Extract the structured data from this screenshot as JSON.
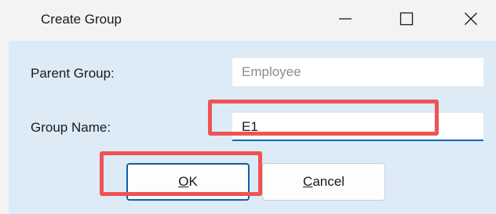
{
  "window": {
    "title": "Create Group",
    "controls": [
      "minimize-icon",
      "maximize-icon",
      "close-icon"
    ]
  },
  "form": {
    "parent_group_label": "Parent Group:",
    "parent_group_value": "Employee",
    "group_name_label": "Group Name:",
    "group_name_value": "E1"
  },
  "buttons": {
    "ok_mnemonic": "O",
    "ok_rest": "K",
    "cancel_mnemonic": "C",
    "cancel_rest": "ancel"
  },
  "annotations": {
    "highlight_color": "#ef5353"
  },
  "colors": {
    "titlebar_bg": "#f3f3f3",
    "client_bg": "#dcebf6",
    "focus_underline": "#0067c0",
    "default_button_border": "#0f5ea8"
  }
}
